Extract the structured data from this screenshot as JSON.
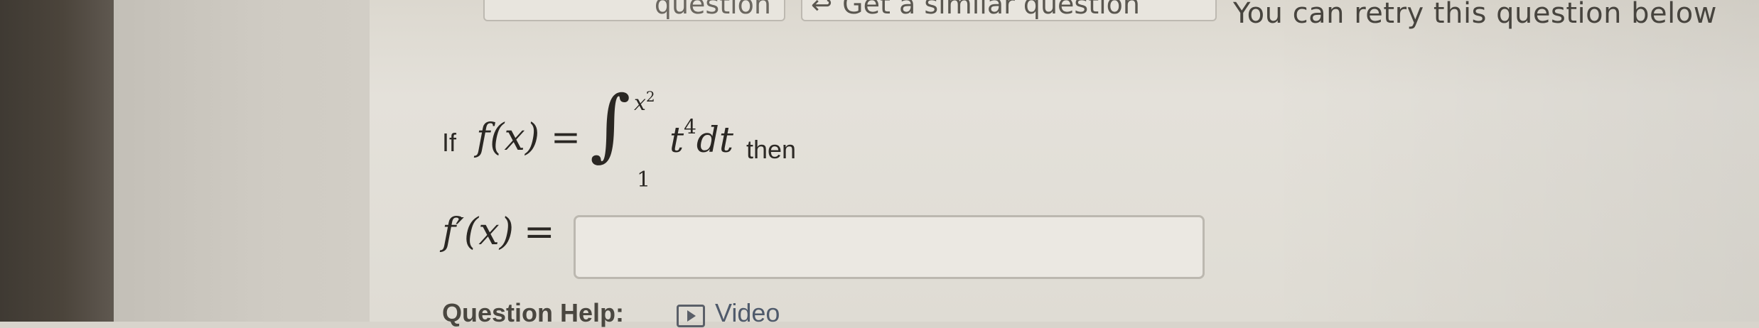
{
  "toolbar": {
    "left_button_label": "question",
    "similar_label": "Get a similar question",
    "retry_note": "You can retry this question below"
  },
  "question": {
    "intro": "If",
    "function_lhs": "f(x)",
    "equals": "=",
    "integral_sign": "∫",
    "upper_limit_base": "x",
    "upper_limit_exp": "2",
    "lower_limit": "1",
    "integrand_base": "t",
    "integrand_exp": "4",
    "differential": "dt",
    "conclusion": "then"
  },
  "answer": {
    "label": "f′(x)",
    "equals": "=",
    "value": "",
    "placeholder": ""
  },
  "help": {
    "label": "Question Help:",
    "video_label": "Video"
  },
  "icons": {
    "similar": "return-arrow-icon",
    "video": "video-play-icon"
  },
  "colors": {
    "text": "#2d2a26",
    "input_border": "#bcb8b0",
    "link": "#4f5a6b"
  }
}
